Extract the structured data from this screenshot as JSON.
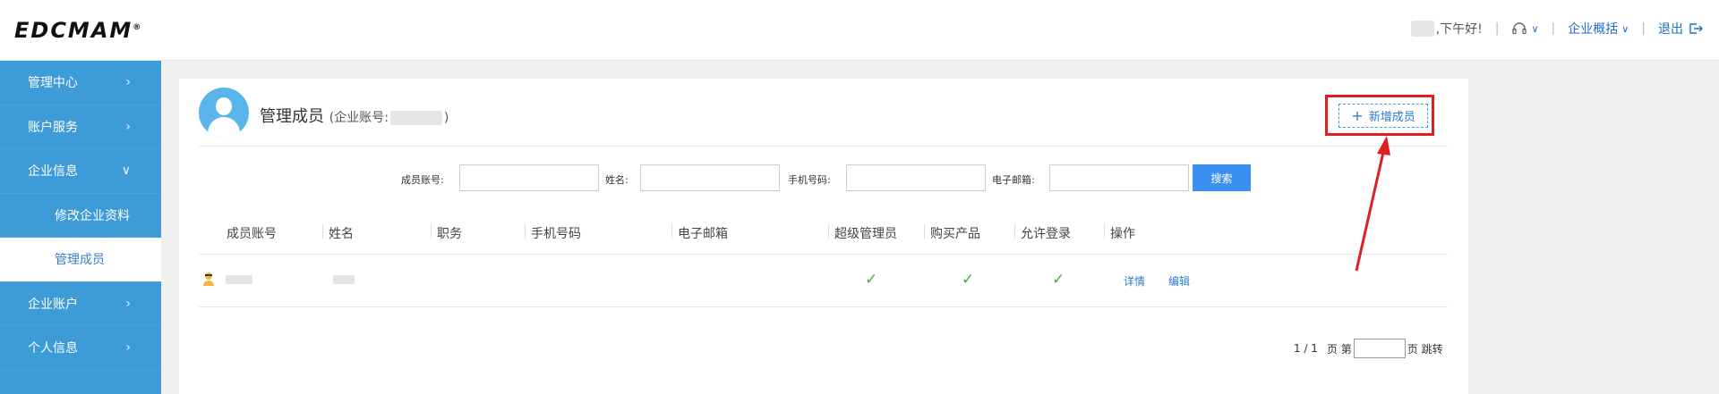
{
  "header": {
    "logo": {
      "main": "EDCMAM",
      "registered": "®"
    },
    "greeting": ",下午好!",
    "support_icon": "headset-icon",
    "enterprise_overview": "企业概括",
    "logout": "退出",
    "logout_icon": "logout-icon"
  },
  "sidebar": {
    "items": [
      {
        "label": "管理中心"
      },
      {
        "label": "账户服务"
      },
      {
        "label": "企业信息"
      },
      {
        "label": "修改企业资料"
      },
      {
        "label": "管理成员"
      },
      {
        "label": "企业账户"
      },
      {
        "label": "个人信息"
      }
    ],
    "accent_color": "#3d9bd8"
  },
  "main": {
    "title": "管理成员",
    "subtitle_prefix": "(企业账号:",
    "subtitle_suffix": ")",
    "add_member": "新增成员",
    "search": {
      "account_label": "成员账号:",
      "name_label": "姓名:",
      "phone_label": "手机号码:",
      "email_label": "电子邮箱:",
      "button": "搜索"
    },
    "table": {
      "headers": [
        "成员账号",
        "姓名",
        "职务",
        "手机号码",
        "电子邮箱",
        "超级管理员",
        "购买产品",
        "允许登录",
        "操作"
      ],
      "rows": [
        {
          "super_admin": "✓",
          "purchase": "✓",
          "allow_login": "✓",
          "detail": "详情",
          "edit": "编辑"
        }
      ]
    },
    "pager": {
      "page_info": "1 / 1",
      "page_label": "页 第",
      "jump": "页 跳转"
    }
  },
  "colors": {
    "primary": "#3b8ff0",
    "annotation": "#e02020",
    "check": "#3cb34a"
  }
}
